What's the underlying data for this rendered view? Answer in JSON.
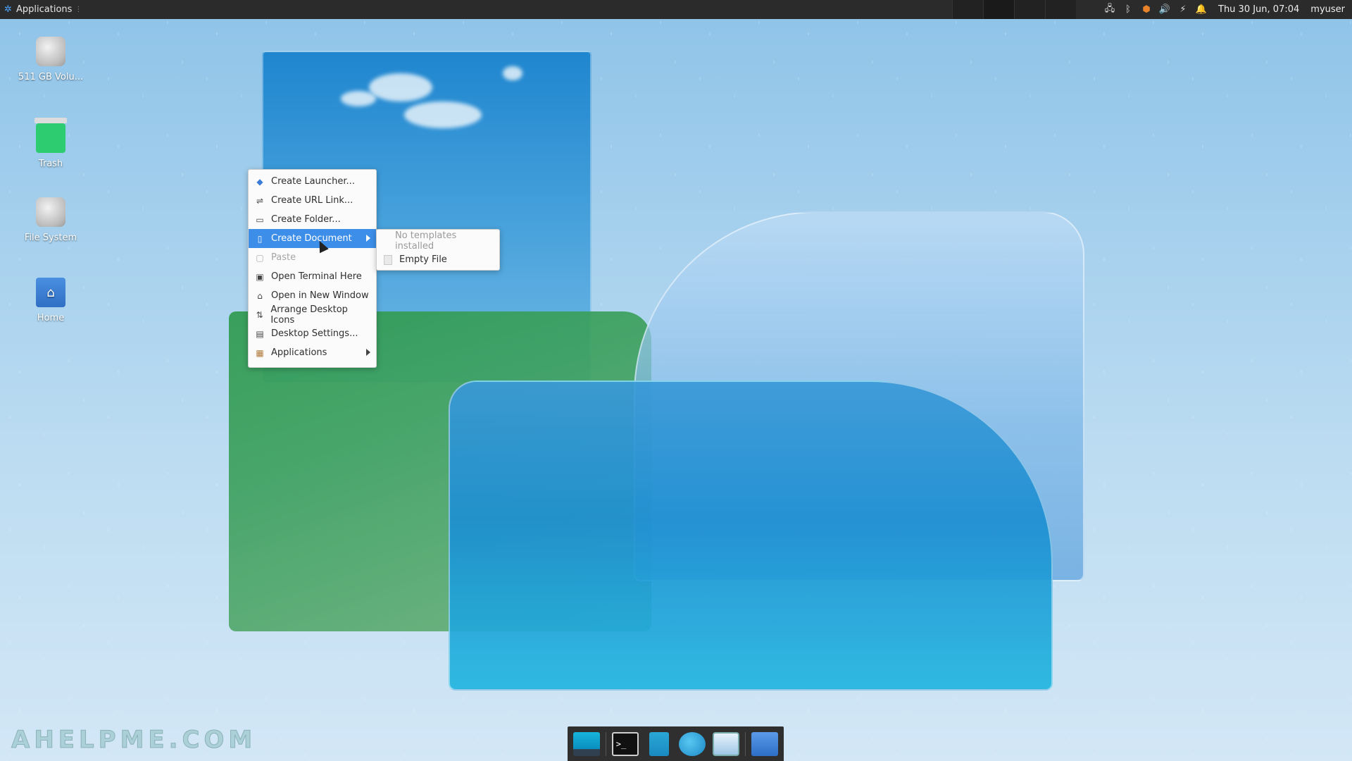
{
  "top_panel": {
    "applications_label": "Applications",
    "clock": "Thu 30 Jun, 07:04",
    "user": "myuser"
  },
  "desktop_icons": [
    {
      "label": "511 GB Volu..."
    },
    {
      "label": "Trash"
    },
    {
      "label": "File System"
    },
    {
      "label": "Home"
    }
  ],
  "context_menu": {
    "items": [
      {
        "label": "Create Launcher...",
        "icon": "launcher-icon"
      },
      {
        "label": "Create URL Link...",
        "icon": "link-icon"
      },
      {
        "label": "Create Folder...",
        "icon": "folder-add-icon"
      },
      {
        "label": "Create Document",
        "icon": "document-add-icon",
        "submenu": true,
        "state": "highlighted"
      },
      {
        "label": "Paste",
        "icon": "paste-icon",
        "state": "disabled"
      },
      {
        "label": "Open Terminal Here",
        "icon": "terminal-icon"
      },
      {
        "label": "Open in New Window",
        "icon": "folder-open-icon"
      },
      {
        "label": "Arrange Desktop Icons",
        "icon": "sort-icon"
      },
      {
        "label": "Desktop Settings...",
        "icon": "desktop-settings-icon"
      },
      {
        "label": "Applications",
        "icon": "applications-icon",
        "submenu": true
      }
    ]
  },
  "submenu": {
    "header": "No templates installed",
    "items": [
      {
        "label": "Empty File",
        "icon": "empty-file-icon"
      }
    ]
  },
  "dock": {
    "items": [
      "show-desktop",
      "terminal",
      "file-manager",
      "web-browser",
      "app-finder",
      "home-folder"
    ]
  },
  "watermark": "AHELPME.COM",
  "colors": {
    "menu_highlight": "#3d8ee8",
    "panel_bg": "#2b2b2b"
  }
}
